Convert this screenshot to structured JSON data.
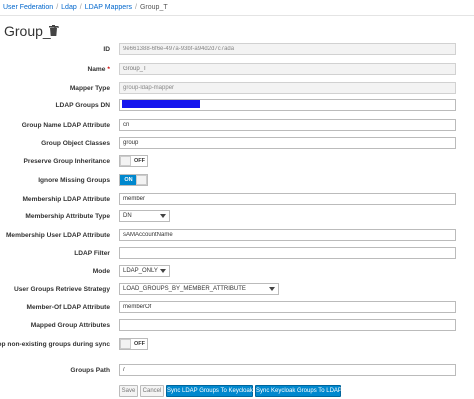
{
  "breadcrumb": {
    "items": [
      "User Federation",
      "Ldap",
      "LDAP Mappers"
    ],
    "separator": "/",
    "current": "Group_T"
  },
  "header": {
    "title": "Group_T",
    "delete_icon": "trash-icon"
  },
  "form": {
    "id": {
      "label": "ID",
      "value": "9e661388-6f6e-497a-93bf-a94d2d7c7ada"
    },
    "name": {
      "label": "Name",
      "required_mark": "*",
      "placeholder": "Group_T"
    },
    "mapper_type": {
      "label": "Mapper Type",
      "value": "group-ldap-mapper"
    },
    "ldap_groups_dn": {
      "label": "LDAP Groups DN",
      "value": ""
    },
    "group_name_ldap_attribute": {
      "label": "Group Name LDAP Attribute",
      "value": "cn"
    },
    "group_object_classes": {
      "label": "Group Object Classes",
      "value": "group"
    },
    "preserve_group_inheritance": {
      "label": "Preserve Group Inheritance",
      "state": "OFF"
    },
    "ignore_missing_groups": {
      "label": "Ignore Missing Groups",
      "state": "ON"
    },
    "membership_ldap_attribute": {
      "label": "Membership LDAP Attribute",
      "value": "member"
    },
    "membership_attribute_type": {
      "label": "Membership Attribute Type",
      "value": "DN"
    },
    "membership_user_ldap_attribute": {
      "label": "Membership User LDAP Attribute",
      "value": "sAMAccountName"
    },
    "ldap_filter": {
      "label": "LDAP Filter",
      "value": ""
    },
    "mode": {
      "label": "Mode",
      "value": "LDAP_ONLY"
    },
    "user_groups_retrieve_strategy": {
      "label": "User Groups Retrieve Strategy",
      "value": "LOAD_GROUPS_BY_MEMBER_ATTRIBUTE"
    },
    "member_of_ldap_attribute": {
      "label": "Member-Of LDAP Attribute",
      "value": "memberOf"
    },
    "mapped_group_attributes": {
      "label": "Mapped Group Attributes",
      "value": ""
    },
    "drop_non_existing_groups": {
      "label": "Drop non-existing groups during sync",
      "state": "OFF"
    },
    "groups_path": {
      "label": "Groups Path",
      "value": "/"
    }
  },
  "buttons": {
    "save": "Save",
    "cancel": "Cancel",
    "sync_ldap_to_keycloak": "Sync LDAP Groups To Keycloak",
    "sync_keycloak_to_ldap": "Sync Keycloak Groups To LDAP"
  },
  "colors": {
    "link": "#0066cc",
    "primary": "#0088ce",
    "required": "#cc0000",
    "redaction": "#1515ee"
  }
}
